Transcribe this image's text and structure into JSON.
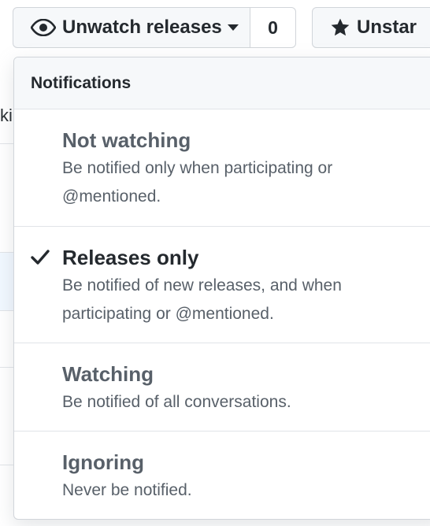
{
  "header_buttons": {
    "watch": {
      "label": "Unwatch releases",
      "icon": "eye-icon"
    },
    "watch_count": "0",
    "star": {
      "label": "Unstar",
      "icon": "star-icon"
    }
  },
  "background": {
    "partial_text": "ki"
  },
  "menu": {
    "header": "Notifications",
    "items": [
      {
        "title": "Not watching",
        "description": "Be notified only when participating or @mentioned.",
        "selected": false
      },
      {
        "title": "Releases only",
        "description": "Be notified of new releases, and when participating or @mentioned.",
        "selected": true
      },
      {
        "title": "Watching",
        "description": "Be notified of all conversations.",
        "selected": false
      },
      {
        "title": "Ignoring",
        "description": "Never be notified.",
        "selected": false
      }
    ]
  },
  "colors": {
    "text": "#24292e",
    "muted": "#586069",
    "border": "#d1d5da",
    "button_bg": "#f6f8fa"
  }
}
